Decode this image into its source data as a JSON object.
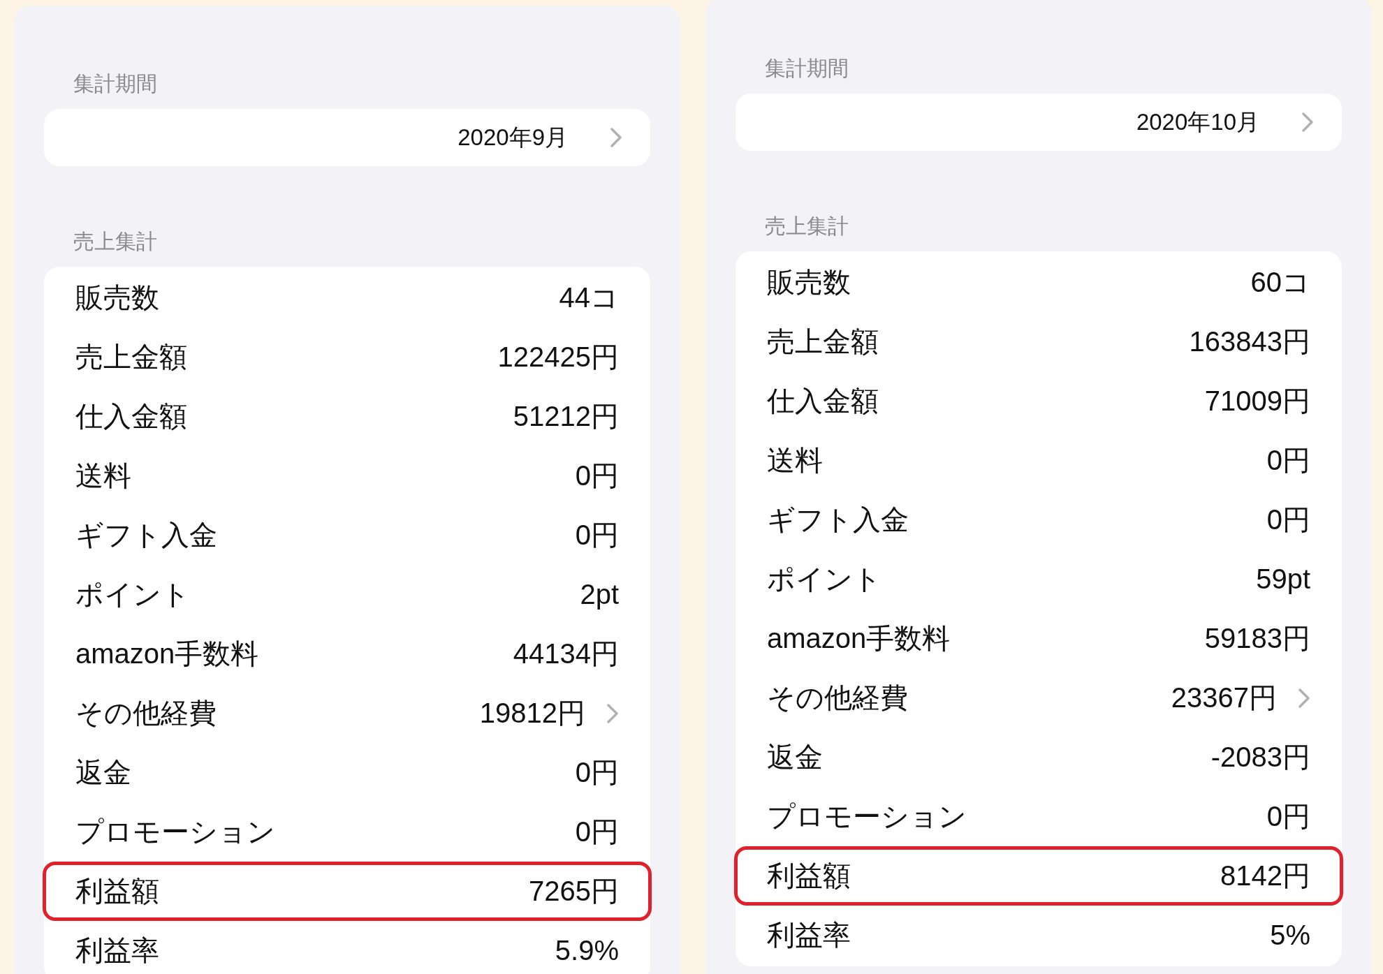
{
  "panels": [
    {
      "period_label": "集計期間",
      "period": "2020年9月",
      "summary_label": "売上集計",
      "rows": [
        {
          "label": "販売数",
          "value": "44コ",
          "chevron": false,
          "highlighted": false
        },
        {
          "label": "売上金額",
          "value": "122425円",
          "chevron": false,
          "highlighted": false
        },
        {
          "label": "仕入金額",
          "value": "51212円",
          "chevron": false,
          "highlighted": false
        },
        {
          "label": "送料",
          "value": "0円",
          "chevron": false,
          "highlighted": false
        },
        {
          "label": "ギフト入金",
          "value": "0円",
          "chevron": false,
          "highlighted": false
        },
        {
          "label": "ポイント",
          "value": "2pt",
          "chevron": false,
          "highlighted": false
        },
        {
          "label": "amazon手数料",
          "value": "44134円",
          "chevron": false,
          "highlighted": false
        },
        {
          "label": "その他経費",
          "value": "19812円",
          "chevron": true,
          "highlighted": false
        },
        {
          "label": "返金",
          "value": "0円",
          "chevron": false,
          "highlighted": false
        },
        {
          "label": "プロモーション",
          "value": "0円",
          "chevron": false,
          "highlighted": false
        },
        {
          "label": "利益額",
          "value": "7265円",
          "chevron": false,
          "highlighted": true
        },
        {
          "label": "利益率",
          "value": "5.9%",
          "chevron": false,
          "highlighted": false
        }
      ]
    },
    {
      "period_label": "集計期間",
      "period": "2020年10月",
      "summary_label": "売上集計",
      "rows": [
        {
          "label": "販売数",
          "value": "60コ",
          "chevron": false,
          "highlighted": false
        },
        {
          "label": "売上金額",
          "value": "163843円",
          "chevron": false,
          "highlighted": false
        },
        {
          "label": "仕入金額",
          "value": "71009円",
          "chevron": false,
          "highlighted": false
        },
        {
          "label": "送料",
          "value": "0円",
          "chevron": false,
          "highlighted": false
        },
        {
          "label": "ギフト入金",
          "value": "0円",
          "chevron": false,
          "highlighted": false
        },
        {
          "label": "ポイント",
          "value": "59pt",
          "chevron": false,
          "highlighted": false
        },
        {
          "label": "amazon手数料",
          "value": "59183円",
          "chevron": false,
          "highlighted": false
        },
        {
          "label": "その他経費",
          "value": "23367円",
          "chevron": true,
          "highlighted": false
        },
        {
          "label": "返金",
          "value": "-2083円",
          "chevron": false,
          "highlighted": false
        },
        {
          "label": "プロモーション",
          "value": "0円",
          "chevron": false,
          "highlighted": false
        },
        {
          "label": "利益額",
          "value": "8142円",
          "chevron": false,
          "highlighted": true
        },
        {
          "label": "利益率",
          "value": "5%",
          "chevron": false,
          "highlighted": false
        }
      ]
    }
  ]
}
